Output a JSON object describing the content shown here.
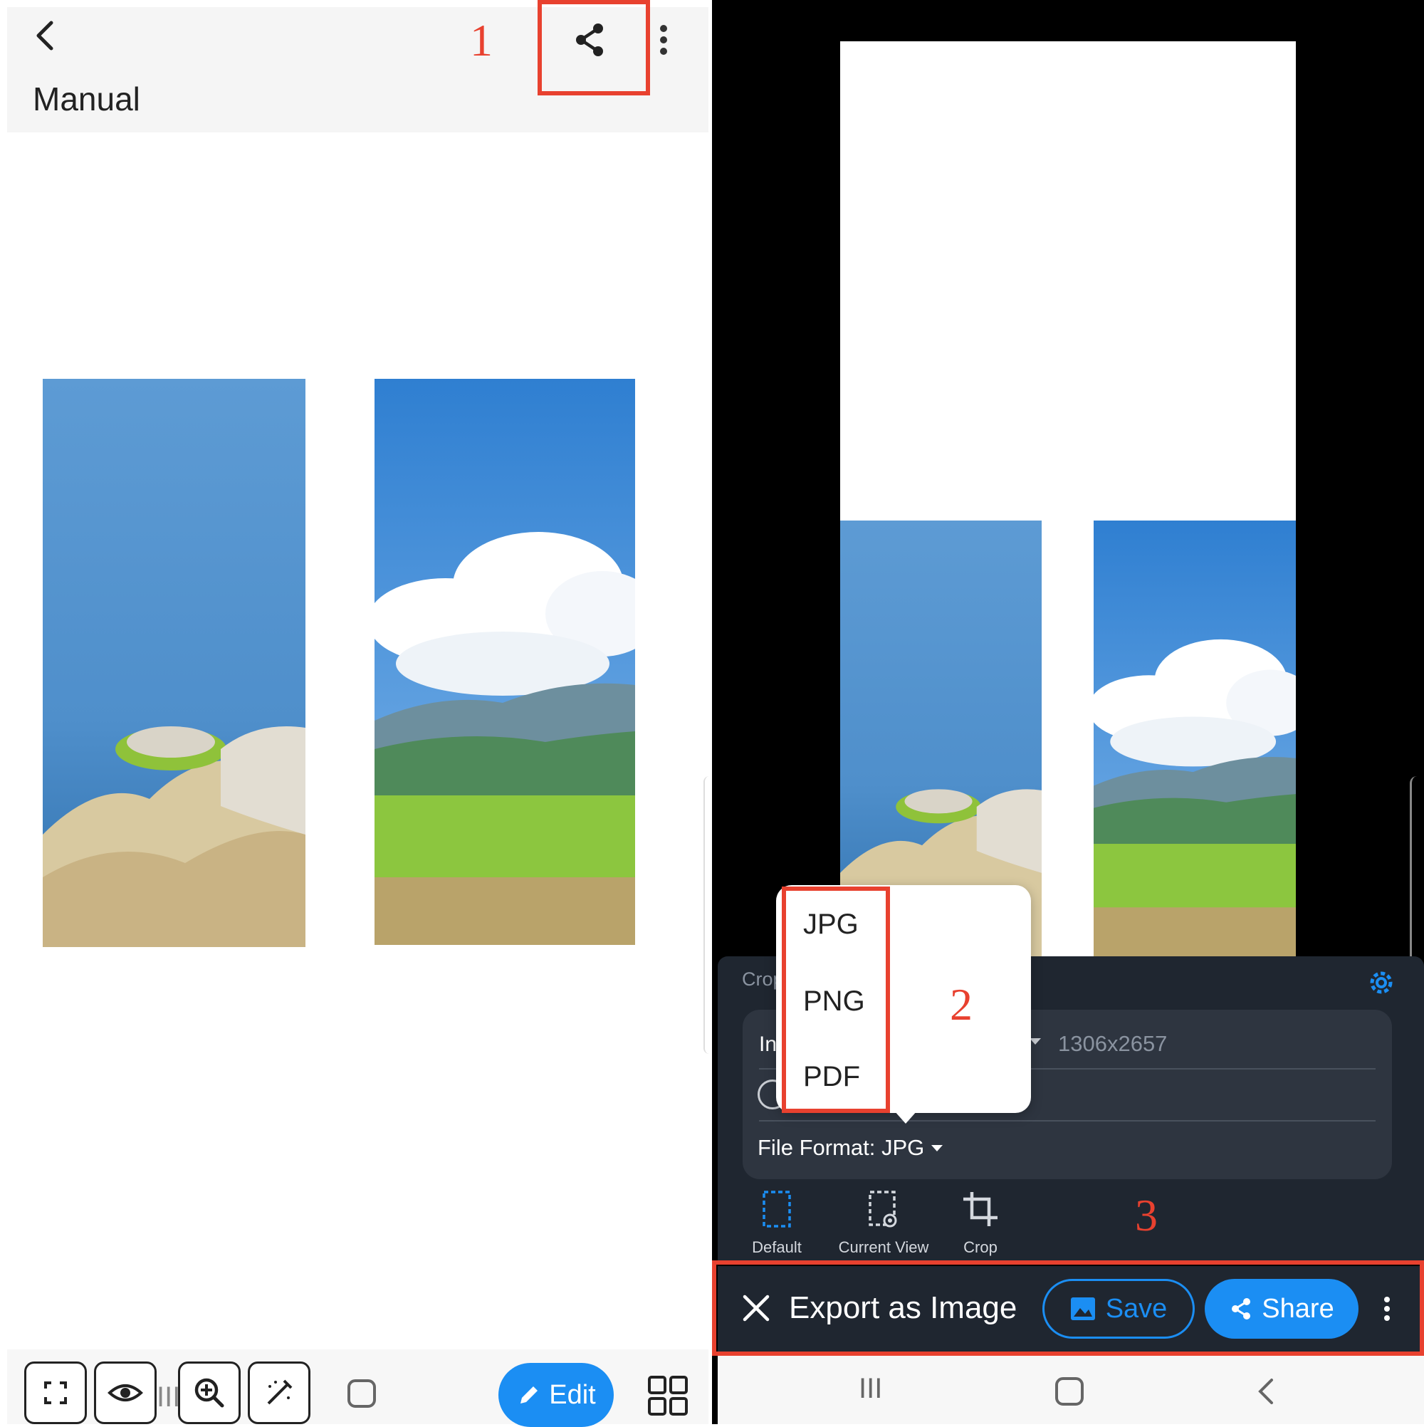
{
  "left": {
    "header": {
      "title": "Manual"
    },
    "annotation": "1",
    "bottom_bar": {
      "edit_label": "Edit",
      "nav_recent": "III"
    }
  },
  "right": {
    "panel": {
      "crop_label": "Crop",
      "option_label_partial": "In",
      "resolution": "1306x2657",
      "file_format": "File Format: JPG"
    },
    "format_menu": {
      "options": [
        "JPG",
        "PNG",
        "PDF"
      ],
      "annotation": "2"
    },
    "modes": [
      {
        "label": "Default",
        "icon": "default-frame-icon"
      },
      {
        "label": "Current View",
        "icon": "current-view-icon"
      },
      {
        "label": "Crop",
        "icon": "crop-icon"
      }
    ],
    "annotation": "3",
    "action_bar": {
      "title": "Export as Image",
      "save_label": "Save",
      "share_label": "Share"
    },
    "nav": {
      "recent": "III"
    }
  },
  "colors": {
    "accent_blue": "#1b8ef3",
    "annotation_red": "#e8412f",
    "panel_dark": "#1f2630",
    "card_dark": "#2e3540"
  }
}
